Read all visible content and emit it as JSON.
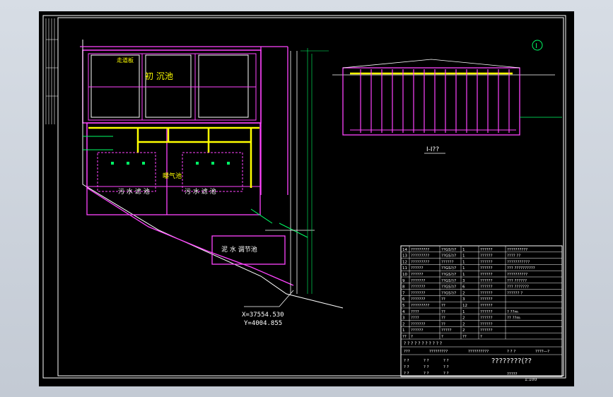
{
  "drawing": {
    "plan_labels": {
      "primary_sedimentation": "初 沉池",
      "walkway": "走道板",
      "aeration_tank": "曝气池",
      "filter_left": "污 水 滤 池",
      "filter_right": "污 水 滤 池",
      "sludge_tank": "泥 水 调节池",
      "coordinate_x": "X=37554.530",
      "coordinate_y": "Y=4004.855"
    },
    "section_title": "I-I??",
    "north_symbol": "I",
    "colors": {
      "background": "#000000",
      "frame": "#ffffff",
      "wall": "#ff44ff",
      "pipe": "#ffff00",
      "dim": "#00ff00",
      "label": "#ffffff"
    }
  },
  "title_block": {
    "rows": [
      {
        "no": "14",
        "name": "?????????",
        "spec": "??GS?/?",
        "qty": "1",
        "unit": "??????",
        "note": "??????????"
      },
      {
        "no": "13",
        "name": "?????????",
        "spec": "??GS?/?",
        "qty": "1",
        "unit": "??????",
        "note": "???? ??"
      },
      {
        "no": "12",
        "name": "?????????",
        "spec": "??????",
        "qty": "1",
        "unit": "??????",
        "note": "???????????"
      },
      {
        "no": "11",
        "name": "??????",
        "spec": "??GS?/?",
        "qty": "1",
        "unit": "??????",
        "note": "??? ??????????"
      },
      {
        "no": "10",
        "name": "??????",
        "spec": "??GS?/?",
        "qty": "1",
        "unit": "??????",
        "note": "??????????"
      },
      {
        "no": "9",
        "name": "???????",
        "spec": "??GS?/?",
        "qty": "3",
        "unit": "??????",
        "note": "??? ??????"
      },
      {
        "no": "8",
        "name": "???????",
        "spec": "??GS?/?",
        "qty": "6",
        "unit": "??????",
        "note": "??? ???????"
      },
      {
        "no": "7",
        "name": "???????",
        "spec": "??GS?/?",
        "qty": "2",
        "unit": "??????",
        "note": "?????? ?"
      },
      {
        "no": "6",
        "name": "???????",
        "spec": "??",
        "qty": "3",
        "unit": "??????",
        "note": ""
      },
      {
        "no": "5",
        "name": "?????????",
        "spec": "??",
        "qty": "12",
        "unit": "??????",
        "note": ""
      },
      {
        "no": "4",
        "name": "????",
        "spec": "??",
        "qty": "1",
        "unit": "??????",
        "note": "?  ??m"
      },
      {
        "no": "3",
        "name": "????",
        "spec": "??",
        "qty": "2",
        "unit": "??????",
        "note": "??  ??m"
      },
      {
        "no": "2",
        "name": "???????",
        "spec": "??",
        "qty": "2",
        "unit": "??????",
        "note": ""
      },
      {
        "no": "1",
        "name": "??????",
        "spec": "?????",
        "qty": "2",
        "unit": "??????",
        "note": ""
      },
      {
        "no": "??",
        "name": "?",
        "spec": "?",
        "qty": "??",
        "unit": "?",
        "note": ""
      }
    ],
    "header_line": "?  ?  ?  ?  ?  ?  ?  ?  ?  ?  ?",
    "designer_row": [
      "???",
      "?????????",
      "??????????",
      "?  ?  ?",
      "????—?"
    ],
    "drawing_title": "????????(??",
    "sub_rows": [
      [
        "?  ?",
        "?  ?",
        "?  ?"
      ],
      [
        "?  ?",
        "?  ?",
        "?  ?"
      ],
      [
        "?  ?",
        "?  ?",
        "?  ?"
      ]
    ],
    "scale_label": "?????",
    "ratio": "1:100"
  }
}
